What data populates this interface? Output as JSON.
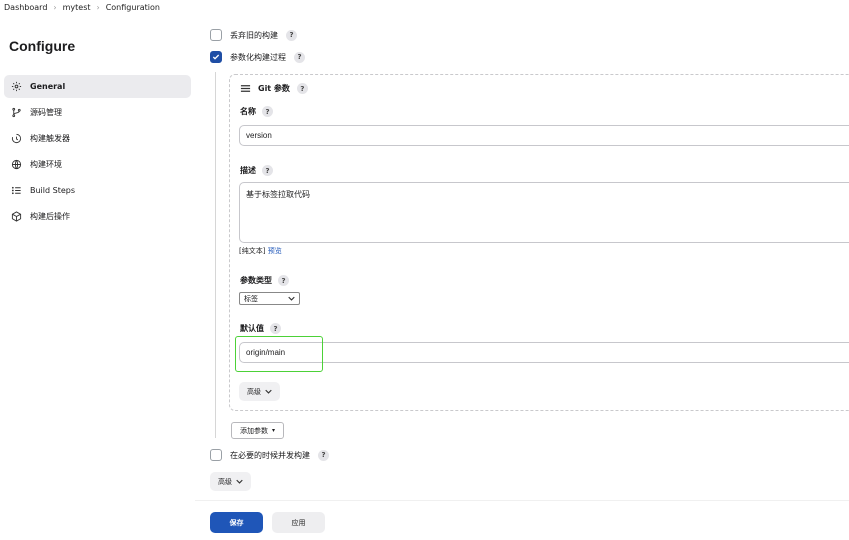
{
  "breadcrumb": [
    "Dashboard",
    "mytest",
    "Configuration"
  ],
  "sidebar": {
    "title": "Configure",
    "items": [
      {
        "label": "General",
        "icon": "gear-icon",
        "active": true
      },
      {
        "label": "源码管理",
        "icon": "branch-icon"
      },
      {
        "label": "构建触发器",
        "icon": "clock-icon"
      },
      {
        "label": "构建环境",
        "icon": "globe-icon"
      },
      {
        "label": "Build Steps",
        "icon": "list-icon"
      },
      {
        "label": "构建后操作",
        "icon": "cube-icon"
      }
    ]
  },
  "general": {
    "discard_builds": {
      "label": "丢弃旧的构建",
      "checked": false
    },
    "parameterized": {
      "label": "参数化构建过程",
      "checked": true
    },
    "git_param": {
      "header": "Git 参数",
      "name_label": "名称",
      "name_value": "version",
      "desc_label": "描述",
      "desc_value": "基于标签拉取代码",
      "plain_text": "[纯文本]",
      "preview": "预览",
      "type_label": "参数类型",
      "type_value": "标签",
      "default_label": "默认值",
      "default_value": "origin/main",
      "advanced": "高级"
    },
    "add_param": "添加参数",
    "concurrent": {
      "label": "在必要的时候并发构建",
      "checked": false
    },
    "advanced": "高级"
  },
  "footer": {
    "save": "保存",
    "apply": "应用"
  },
  "help_symbol": "?",
  "colors": {
    "primary": "#1f56b8",
    "annotation": "#4cd137"
  }
}
